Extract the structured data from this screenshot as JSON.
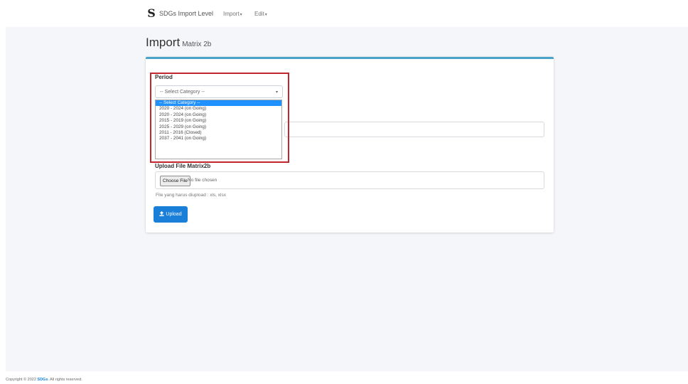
{
  "navbar": {
    "brand_logo": "S",
    "brand_name": "SDGs Import Level",
    "nav_items": [
      {
        "label": "Import",
        "caret": "▾"
      },
      {
        "label": "Edit",
        "caret": "▾"
      }
    ]
  },
  "page": {
    "title": "Import",
    "subtitle": "Matrix 2b"
  },
  "form": {
    "period_label": "Period",
    "select": {
      "selected": "-- Select Category --",
      "arrow": "▾",
      "options": [
        "-- Select Category --",
        "2020 - 2024 (on Going)",
        "2020 - 2024 (on Going)",
        "2015 - 2019 (on Going)",
        "2025 - 2029 (on Going)",
        "2011 - 2016 (Closed)",
        "2037 - 2041 (on Going)"
      ]
    },
    "upload_label": "Upload File Matrix2b",
    "choose_button": "Choose File",
    "no_file_text": "No file chosen",
    "hint_text": "File yang harus diupload : xls, xlsx",
    "upload_icon": "upload-icon",
    "upload_button": "Upload"
  },
  "footer": {
    "prefix": "Copyright © 2022",
    "brand": "SDGs",
    "suffix": ". All rights reserved."
  },
  "colors": {
    "highlight_border": "#c0262c",
    "card_top_border": "#4aa3c8",
    "primary_button": "#1a7fd8",
    "selected_option": "#1e90ff"
  }
}
